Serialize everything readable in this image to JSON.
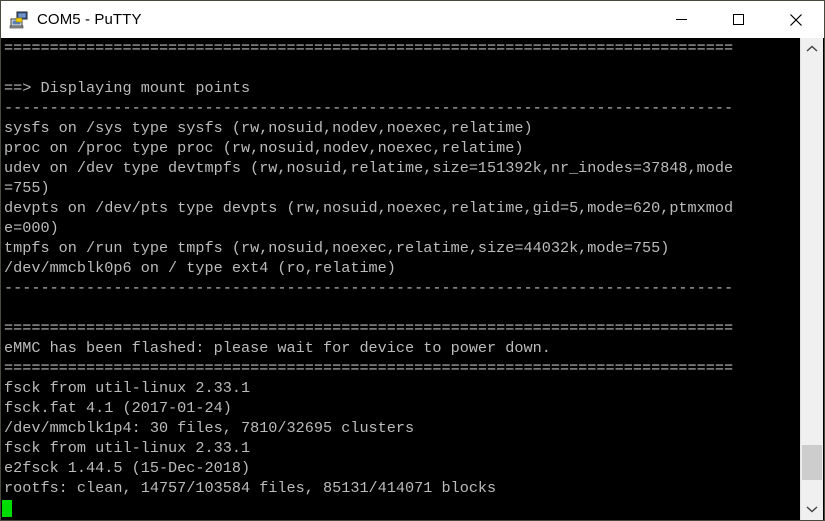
{
  "window": {
    "title": "COM5 - PuTTY",
    "icon": "putty-computer-icon",
    "border_color": "#4a4a3c",
    "titlebar_bg": "#ffffff",
    "controls": [
      {
        "name": "minimize-button",
        "glyph": "minimize"
      },
      {
        "name": "maximize-button",
        "glyph": "maximize"
      },
      {
        "name": "close-button",
        "glyph": "close"
      }
    ]
  },
  "terminal": {
    "background": "#000000",
    "foreground": "#bbbbbb",
    "cursor_color": "#00dd00",
    "lines": [
      "================================================================================",
      "",
      "==> Displaying mount points",
      "--------------------------------------------------------------------------------",
      "sysfs on /sys type sysfs (rw,nosuid,nodev,noexec,relatime)",
      "proc on /proc type proc (rw,nosuid,nodev,noexec,relatime)",
      "udev on /dev type devtmpfs (rw,nosuid,relatime,size=151392k,nr_inodes=37848,mode",
      "=755)",
      "devpts on /dev/pts type devpts (rw,nosuid,noexec,relatime,gid=5,mode=620,ptmxmod",
      "e=000)",
      "tmpfs on /run type tmpfs (rw,nosuid,noexec,relatime,size=44032k,mode=755)",
      "/dev/mmcblk0p6 on / type ext4 (ro,relatime)",
      "--------------------------------------------------------------------------------",
      "",
      "================================================================================",
      "eMMC has been flashed: please wait for device to power down.",
      "================================================================================",
      "fsck from util-linux 2.33.1",
      "fsck.fat 4.1 (2017-01-24)",
      "/dev/mmcblk1p4: 30 files, 7810/32695 clusters",
      "fsck from util-linux 2.33.1",
      "e2fsck 1.44.5 (15-Dec-2018)",
      "rootfs: clean, 14757/103584 files, 85131/414071 blocks"
    ]
  },
  "scrollbar": {
    "up_arrow": "chevron-up-icon",
    "down_arrow": "chevron-down-icon",
    "thumb_top_pct": 88,
    "thumb_height_pct": 8
  }
}
